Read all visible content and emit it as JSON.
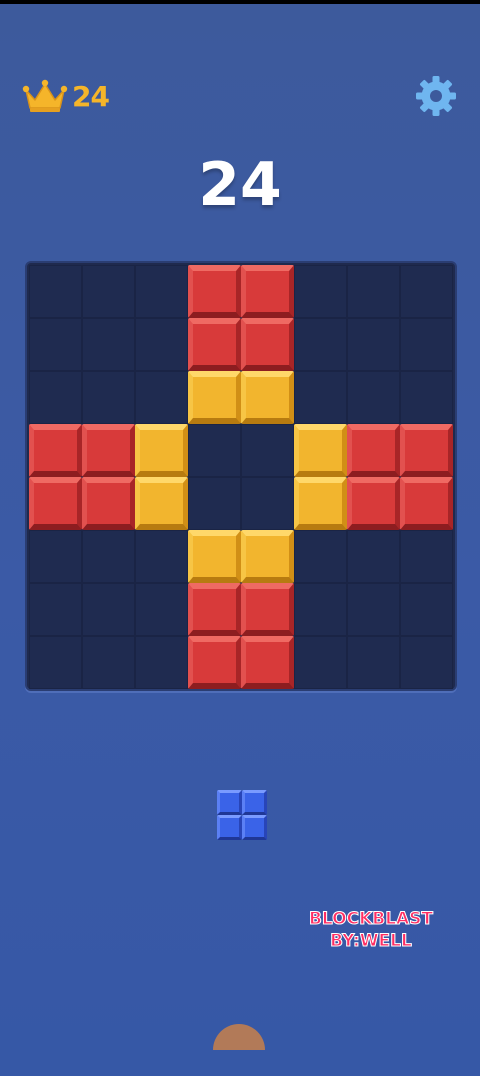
{
  "header": {
    "best_score": "24",
    "crown_icon": "crown-icon",
    "settings_icon": "gear-icon"
  },
  "score": "24",
  "board": {
    "rows": 8,
    "cols": 8,
    "grid": [
      [
        "",
        "",
        "",
        "R",
        "R",
        "",
        "",
        ""
      ],
      [
        "",
        "",
        "",
        "R",
        "R",
        "",
        "",
        ""
      ],
      [
        "",
        "",
        "",
        "Y",
        "Y",
        "",
        "",
        ""
      ],
      [
        "R",
        "R",
        "Y",
        "",
        "",
        "Y",
        "R",
        "R"
      ],
      [
        "R",
        "R",
        "Y",
        "",
        "",
        "Y",
        "R",
        "R"
      ],
      [
        "",
        "",
        "",
        "Y",
        "Y",
        "",
        "",
        ""
      ],
      [
        "",
        "",
        "",
        "R",
        "R",
        "",
        "",
        ""
      ],
      [
        "",
        "",
        "",
        "R",
        "R",
        "",
        "",
        ""
      ]
    ]
  },
  "tray": {
    "pieces": [
      {
        "shape": "2x2-square",
        "color": "blue"
      }
    ]
  },
  "watermark": {
    "line1": "BLOCKBLAST",
    "line2": "BY:WELL"
  },
  "colors": {
    "background": "#3b5aa6",
    "board": "#1f2a4e",
    "red": "#d83a3a",
    "yellow": "#f2b52e",
    "blue": "#3a63e8",
    "best_score": "#f5b52a",
    "watermark": "#ff2e63"
  }
}
